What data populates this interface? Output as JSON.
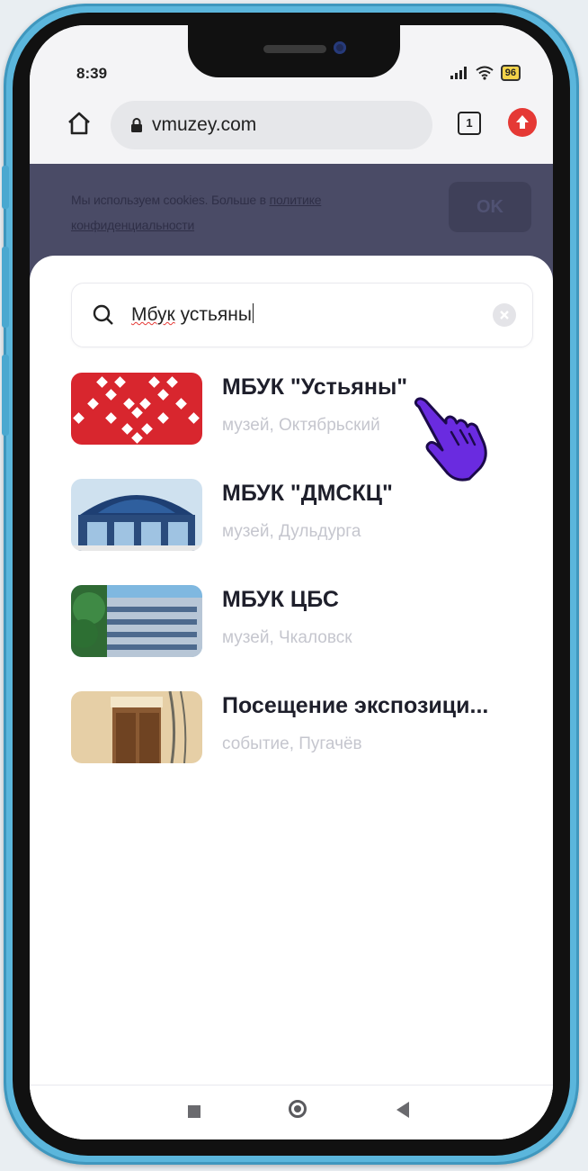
{
  "status_bar": {
    "time": "8:39",
    "battery": "96",
    "signal_icon": "signal-bars-icon",
    "wifi_icon": "wifi-icon"
  },
  "browser": {
    "url": "vmuzey.com",
    "tabs_count": "1"
  },
  "cookie_banner": {
    "text": "Мы используем cookies. Больше в ",
    "link": "политике конфиденциальности",
    "ok_label": "OK"
  },
  "search": {
    "query_underlined": "Мбук",
    "query_rest": " устьяны"
  },
  "results": [
    {
      "title": "МБУК \"Устьяны\"",
      "subtitle": "музей, Октябрьский"
    },
    {
      "title": "МБУК \"ДМСКЦ\"",
      "subtitle": "музей, Дульдурга"
    },
    {
      "title": "МБУК ЦБС",
      "subtitle": "музей, Чкаловск"
    },
    {
      "title": "Посещение экспозици...",
      "subtitle": "событие, Пугачёв"
    }
  ],
  "colors": {
    "frame": "#5bb6dc",
    "cookie_banner": "#4a4b66",
    "title_text": "#1e1f2b",
    "subtitle_text": "#c5c6ce",
    "cursor": "#6a2be0"
  }
}
